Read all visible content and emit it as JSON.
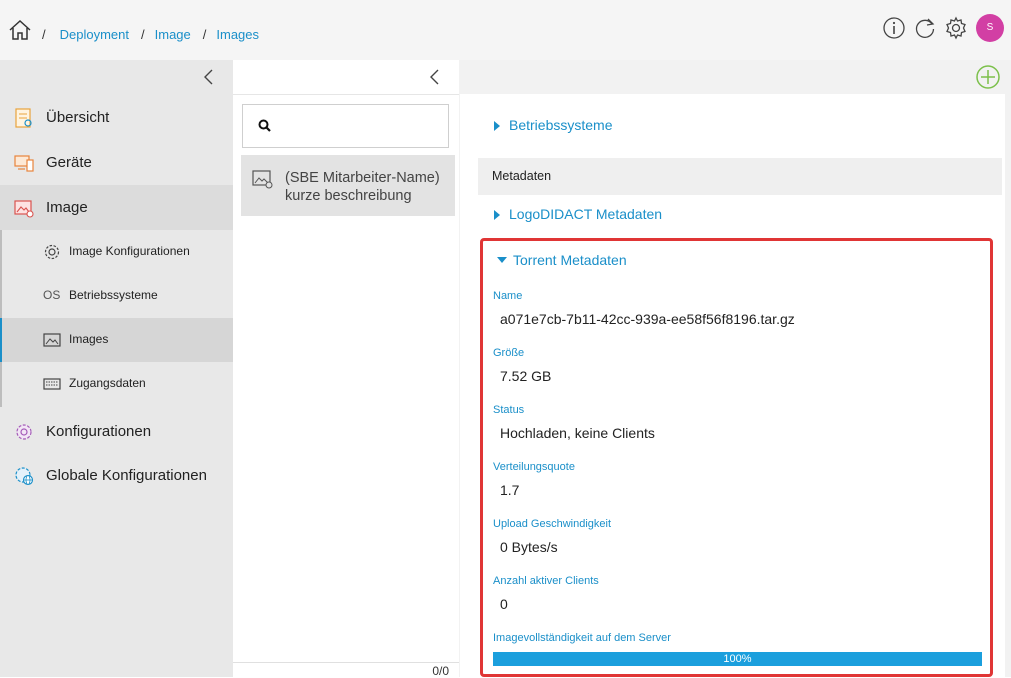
{
  "breadcrumb": [
    {
      "label": "Deployment"
    },
    {
      "label": "Image"
    },
    {
      "label": "Images"
    }
  ],
  "breadcrumb_separator": "/",
  "topbar": {
    "avatar_initial": "S",
    "avatar_color": "#d23fa4",
    "icons": [
      "home-icon",
      "info-icon",
      "refresh-icon",
      "gear-icon"
    ]
  },
  "sidebar": {
    "items": [
      {
        "label": "Übersicht",
        "icon": "overview-icon"
      },
      {
        "label": "Geräte",
        "icon": "devices-icon"
      },
      {
        "label": "Image",
        "icon": "image-icon",
        "active": true
      },
      {
        "label": "Konfigurationen",
        "icon": "configurations-icon"
      },
      {
        "label": "Globale Konfigurationen",
        "icon": "global-config-icon"
      }
    ],
    "subitems": [
      {
        "label": "Image Konfigurationen",
        "icon": "image-config-icon"
      },
      {
        "label": "Betriebssysteme",
        "prefix": "OS"
      },
      {
        "label": "Images",
        "icon": "images-icon",
        "active": true
      },
      {
        "label": "Zugangsdaten",
        "icon": "credentials-icon"
      }
    ]
  },
  "list": {
    "search_placeholder": "",
    "items": [
      {
        "label": "(SBE Mitarbeiter-Name) kurze beschreibung"
      }
    ],
    "count": "0/0"
  },
  "detail": {
    "rows": {
      "betriebssysteme": "Betriebssysteme",
      "metadaten": "Metadaten",
      "logodidact": "LogoDIDACT Metadaten",
      "torrent": "Torrent Metadaten"
    },
    "torrent_fields": [
      {
        "label": "Name",
        "value": "a071e7cb-7b11-42cc-939a-ee58f56f8196.tar.gz"
      },
      {
        "label": "Größe",
        "value": "7.52 GB"
      },
      {
        "label": "Status",
        "value": "Hochladen, keine Clients"
      },
      {
        "label": "Verteilungsquote",
        "value": "1.7"
      },
      {
        "label": "Upload Geschwindigkeit",
        "value": "0 Bytes/s"
      },
      {
        "label": "Anzahl aktiver Clients",
        "value": "0"
      }
    ],
    "completeness": {
      "label": "Imagevollständigkeit auf dem Server",
      "percent": 100,
      "text": "100%"
    }
  },
  "colors": {
    "accent": "#1a8fc9",
    "highlight_border": "#e03535",
    "progress_fill": "#1b9fdd",
    "add_icon": "#7cc04b"
  }
}
